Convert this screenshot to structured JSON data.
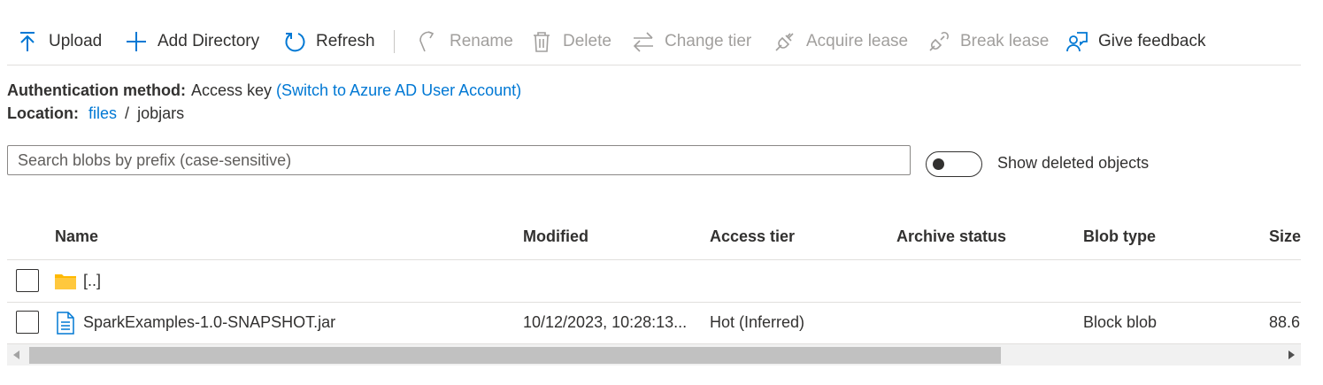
{
  "toolbar": {
    "upload": "Upload",
    "add_directory": "Add Directory",
    "refresh": "Refresh",
    "rename": "Rename",
    "delete": "Delete",
    "change_tier": "Change tier",
    "acquire_lease": "Acquire lease",
    "break_lease": "Break lease",
    "give_feedback": "Give feedback"
  },
  "auth": {
    "label": "Authentication method:",
    "value": "Access key",
    "switch_link": "(Switch to Azure AD User Account)"
  },
  "location": {
    "label": "Location:",
    "root_link": "files",
    "separator": "/",
    "current": "jobjars"
  },
  "search": {
    "placeholder": "Search blobs by prefix (case-sensitive)",
    "value": ""
  },
  "show_deleted": {
    "label": "Show deleted objects",
    "on": false
  },
  "columns": {
    "name": "Name",
    "modified": "Modified",
    "access_tier": "Access tier",
    "archive_status": "Archive status",
    "blob_type": "Blob type",
    "size": "Size"
  },
  "rows": [
    {
      "icon": "folder-icon",
      "name": "[..]",
      "modified": "",
      "access_tier": "",
      "archive_status": "",
      "blob_type": "",
      "size": ""
    },
    {
      "icon": "file-icon",
      "name": "SparkExamples-1.0-SNAPSHOT.jar",
      "modified": "10/12/2023, 10:28:13...",
      "access_tier": "Hot (Inferred)",
      "archive_status": "",
      "blob_type": "Block blob",
      "size": "88.6"
    }
  ],
  "colors": {
    "accent": "#0078d4",
    "text": "#323130",
    "disabled": "#a19f9d",
    "folder": "#ffb900"
  }
}
